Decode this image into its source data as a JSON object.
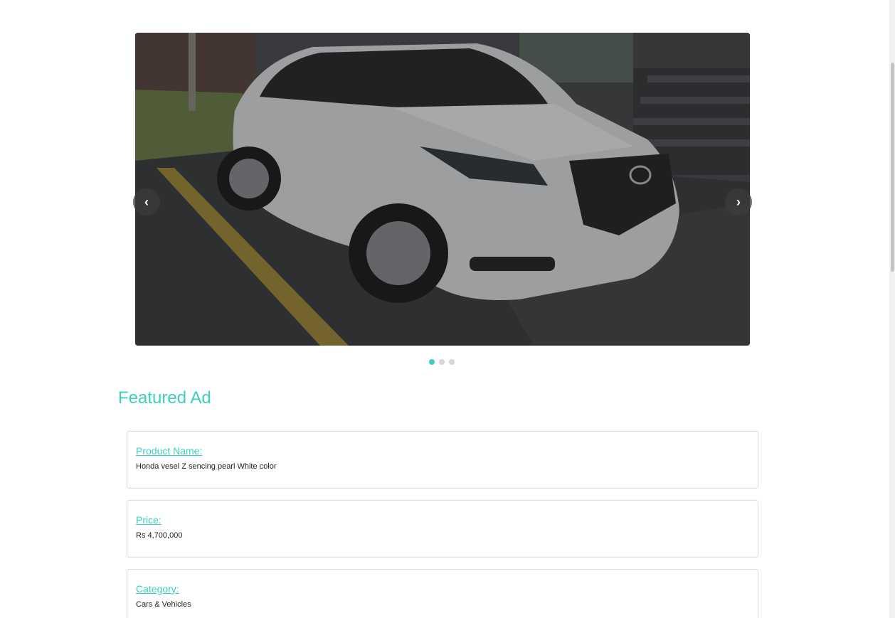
{
  "carousel": {
    "prev_icon": "chevron-left-icon",
    "prev_glyph": "‹",
    "next_icon": "chevron-right-icon",
    "next_glyph": "›",
    "slide_count": 3,
    "active_slide": 1,
    "accent_color": "#3ccfc0"
  },
  "section": {
    "title": "Featured Ad"
  },
  "details": [
    {
      "label": "Product Name:",
      "value": "Honda vesel Z sencing pearl White color"
    },
    {
      "label": "Price:",
      "value": "Rs 4,700,000"
    },
    {
      "label": "Category:",
      "value": "Cars & Vehicles"
    }
  ]
}
